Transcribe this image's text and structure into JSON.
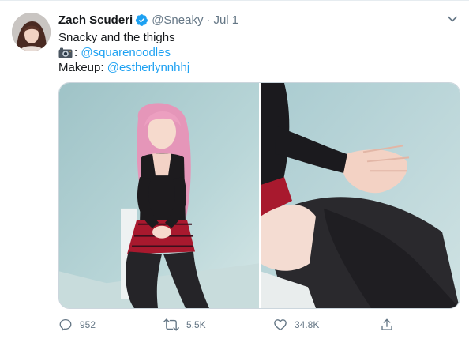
{
  "tweet": {
    "display_name": "Zach Scuderi",
    "handle": "@Sneaky",
    "separator": "·",
    "date": "Jul 1",
    "text_line1": "Snacky and the thighs",
    "photo_credit_sep": ":",
    "photo_credit_link": "@squarenoodles",
    "makeup_label": "Makeup:",
    "makeup_link": "@estherlynnhhj",
    "link_color": "#1da1f2"
  },
  "icons": {
    "verified": "verified-badge-icon",
    "camera": "camera-icon",
    "chevron": "chevron-down-icon",
    "reply": "reply-icon",
    "retweet": "retweet-icon",
    "like": "heart-icon",
    "share": "share-icon"
  },
  "actions": {
    "reply_count": "952",
    "retweet_count": "5.5K",
    "like_count": "34.8K"
  }
}
